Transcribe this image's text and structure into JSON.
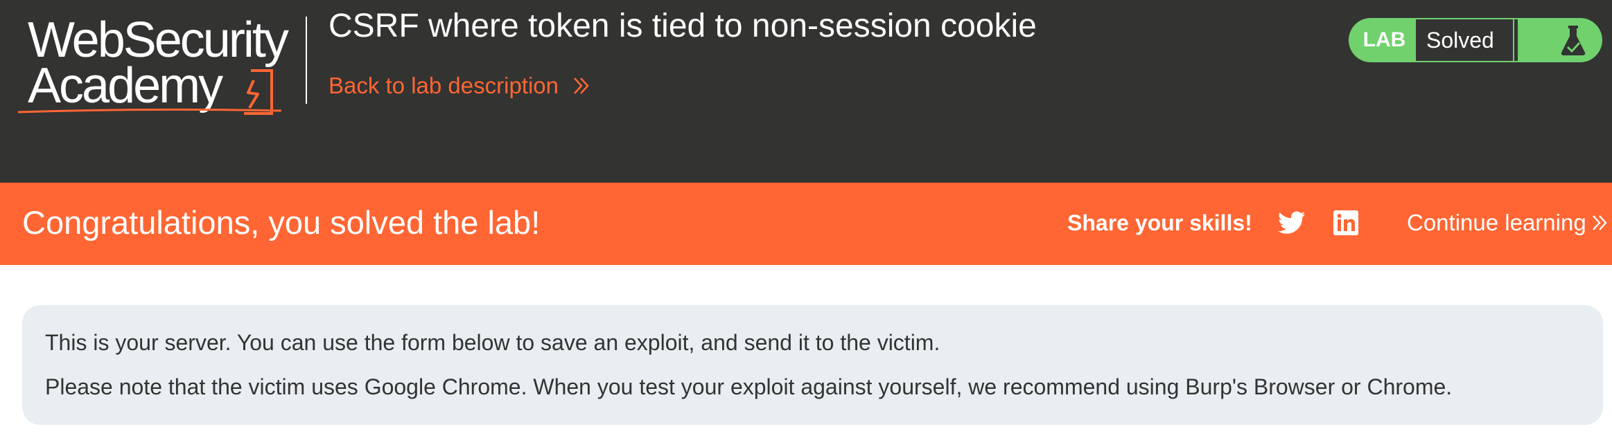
{
  "logo": {
    "line1": "WebSecurity",
    "line2": "Academy"
  },
  "header": {
    "lab_title": "CSRF where token is tied to non-session cookie",
    "back_link": "Back to lab description"
  },
  "status": {
    "label": "LAB",
    "state": "Solved"
  },
  "banner": {
    "message": "Congratulations, you solved the lab!",
    "share_label": "Share your skills!",
    "continue_label": "Continue learning"
  },
  "info": {
    "line1": "This is your server. You can use the form below to save an exploit, and send it to the victim.",
    "line2": "Please note that the victim uses Google Chrome. When you test your exploit against yourself, we recommend using Burp's Browser or Chrome."
  },
  "icons": {
    "logo_mark": "academy-flame-icon",
    "back_chevron": "double-chevron-right-icon",
    "flask": "flask-check-icon",
    "twitter": "twitter-icon",
    "linkedin": "linkedin-icon",
    "continue_chevron": "double-chevron-right-icon"
  },
  "colors": {
    "header_bg": "#333332",
    "accent_orange": "#ff6633",
    "solved_green": "#70d16d",
    "info_bg": "#e8eef1",
    "text_dark": "#333332"
  }
}
